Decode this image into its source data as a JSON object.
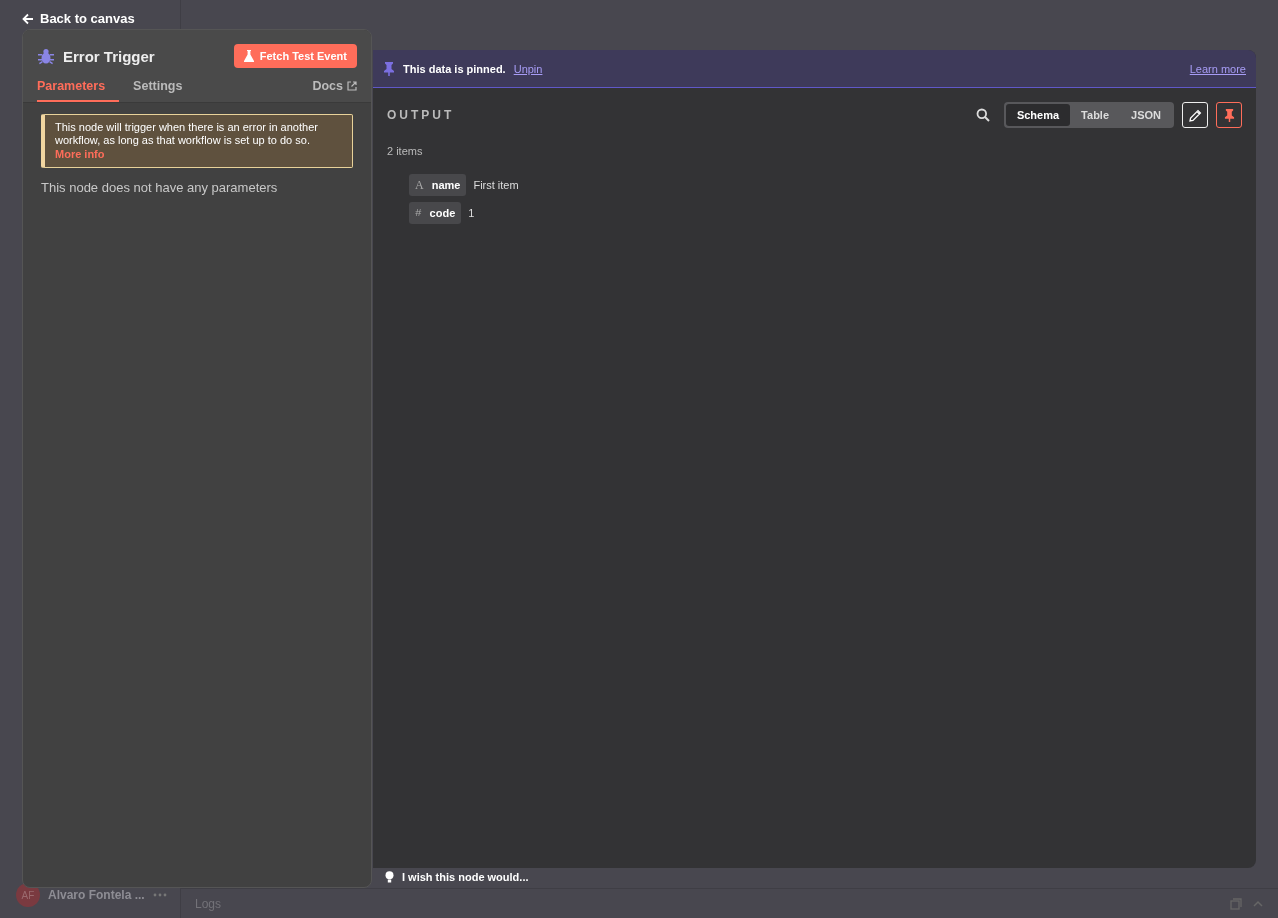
{
  "background": {
    "user_initials": "AF",
    "user_name": "Alvaro Fontela ...",
    "logs_label": "Logs"
  },
  "back_link": "Back to canvas",
  "node_panel": {
    "title": "Error Trigger",
    "fetch_button": "Fetch Test Event",
    "tabs": [
      {
        "label": "Parameters",
        "selected": true
      },
      {
        "label": "Settings",
        "selected": false
      }
    ],
    "docs_link": "Docs",
    "notice": {
      "text": "This node will trigger when there is an error in another workflow, as long as that workflow is set up to do so.",
      "link": "More info"
    },
    "empty_message": "This node does not have any parameters"
  },
  "output_panel": {
    "pinned_banner": {
      "text": "This data is pinned.",
      "unpin_link": "Unpin",
      "learn_more_link": "Learn more"
    },
    "heading": "OUTPUT",
    "view_modes": [
      {
        "label": "Schema",
        "selected": true
      },
      {
        "label": "Table",
        "selected": false
      },
      {
        "label": "JSON",
        "selected": false
      }
    ],
    "pinned": true,
    "item_count": "2 items",
    "fields": [
      {
        "kind": "string",
        "type_icon": "A",
        "key": "name",
        "value": "First item"
      },
      {
        "kind": "number",
        "type_icon": "#",
        "key": "code",
        "value": "1"
      }
    ]
  },
  "feedback_prompt": "I wish this node would..."
}
